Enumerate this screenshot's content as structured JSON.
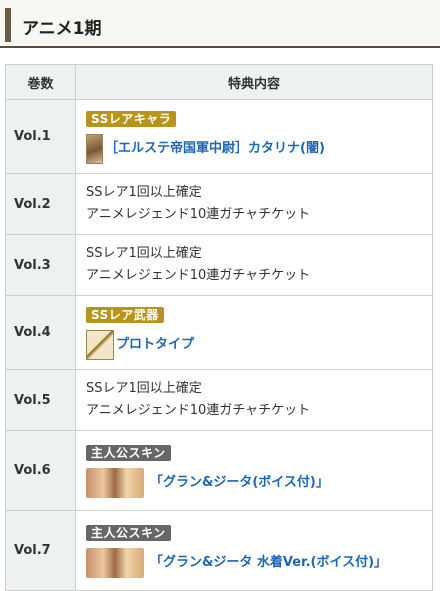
{
  "heading": {
    "title": "アニメ1期"
  },
  "table": {
    "headers": {
      "volume": "巻数",
      "content": "特典内容"
    },
    "rows": [
      {
        "vol": "Vol.1",
        "badge": "SSレアキャラ",
        "item": "［エルステ帝国軍中尉］カタリナ(闇)"
      },
      {
        "vol": "Vol.2",
        "line1": "SSレア1回以上確定",
        "line2": "アニメレジェンド10連ガチャチケット"
      },
      {
        "vol": "Vol.3",
        "line1": "SSレア1回以上確定",
        "line2": "アニメレジェンド10連ガチャチケット"
      },
      {
        "vol": "Vol.4",
        "badge": "SSレア武器",
        "item": "プロトタイプ"
      },
      {
        "vol": "Vol.5",
        "line1": "SSレア1回以上確定",
        "line2": "アニメレジェンド10連ガチャチケット"
      },
      {
        "vol": "Vol.6",
        "badge": "主人公スキン",
        "item": "「グラン&ジータ(ボイス付)」"
      },
      {
        "vol": "Vol.7",
        "badge": "主人公スキン",
        "item": "「グラン&ジータ 水着Ver.(ボイス付)」"
      }
    ]
  },
  "colors": {
    "badge_gold": "#b8941c",
    "badge_gray": "#666666",
    "link": "#1c66b8"
  }
}
